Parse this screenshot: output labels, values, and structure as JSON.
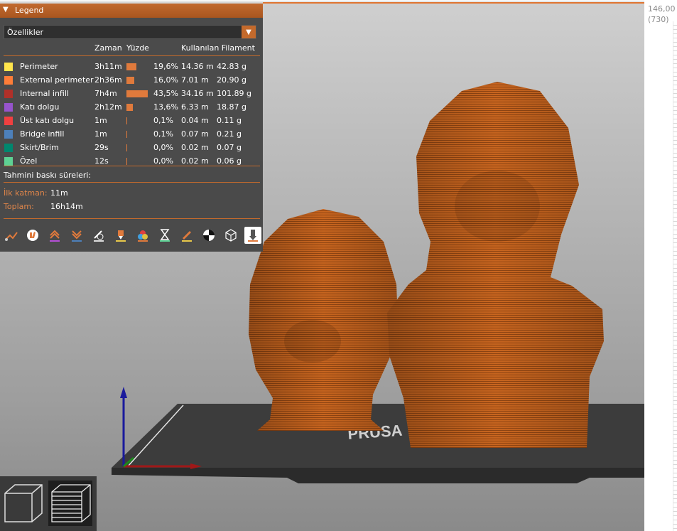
{
  "legend": {
    "title": "Legend",
    "view_type": "Özellikler",
    "headers": {
      "time": "Zaman",
      "percent": "Yüzde",
      "used_filament": "Kullanılan Filament"
    },
    "features": [
      {
        "name": "Perimeter",
        "time": "3h11m",
        "percent": "19,6%",
        "percent_value": 19.6,
        "length": "14.36 m",
        "weight": "42.83 g",
        "color": "#ffe54c"
      },
      {
        "name": "External perimeter",
        "time": "2h36m",
        "percent": "16,0%",
        "percent_value": 16.0,
        "length": "7.01 m",
        "weight": "20.90 g",
        "color": "#ff7d38"
      },
      {
        "name": "Internal infill",
        "time": "7h4m",
        "percent": "43,5%",
        "percent_value": 43.5,
        "length": "34.16 m",
        "weight": "101.89 g",
        "color": "#b03029"
      },
      {
        "name": "Katı dolgu",
        "time": "2h12m",
        "percent": "13,6%",
        "percent_value": 13.6,
        "length": "6.33 m",
        "weight": "18.87 g",
        "color": "#9654cc"
      },
      {
        "name": "Üst katı dolgu",
        "time": "1m",
        "percent": "0,1%",
        "percent_value": 0.1,
        "length": "0.04 m",
        "weight": "0.11 g",
        "color": "#f04040"
      },
      {
        "name": "Bridge infill",
        "time": "1m",
        "percent": "0,1%",
        "percent_value": 0.1,
        "length": "0.07 m",
        "weight": "0.21 g",
        "color": "#4d80ba"
      },
      {
        "name": "Skirt/Brim",
        "time": "29s",
        "percent": "0,0%",
        "percent_value": 0.0,
        "length": "0.02 m",
        "weight": "0.07 g",
        "color": "#00876e"
      },
      {
        "name": "Özel",
        "time": "12s",
        "percent": "0,0%",
        "percent_value": 0.0,
        "length": "0.02 m",
        "weight": "0.06 g",
        "color": "#5ed194"
      }
    ],
    "estimate": {
      "title": "Tahmini baskı süreleri:",
      "first_layer_label": "İlk katman:",
      "first_layer_value": "11m",
      "total_label": "Toplam:",
      "total_value": "16h14m"
    },
    "toolbar_icons": [
      "travel-icon",
      "wipe-icon",
      "retractions-icon",
      "deretractions-icon",
      "seams-icon",
      "tool-changes-icon",
      "color-changes-icon",
      "pause-prints-icon",
      "custom-gcodes-icon",
      "center-of-gravity-icon",
      "shells-icon",
      "tool-marker-icon"
    ]
  },
  "layer_slider": {
    "top_height": "146,00",
    "top_layer": "(730)"
  },
  "view_modes": [
    "3d-view-icon",
    "layers-view-icon"
  ],
  "colors": {
    "accent": "#c46a2c",
    "model": "#c8651f",
    "panel": "#464646"
  }
}
